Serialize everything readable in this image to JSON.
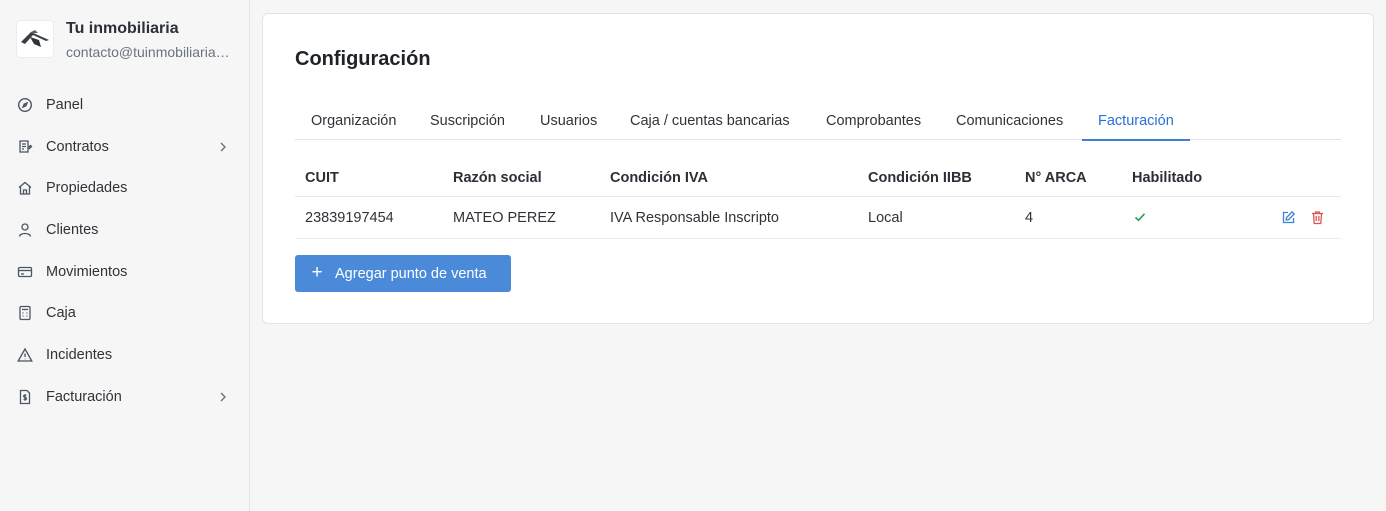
{
  "brand": {
    "name": "Tu inmobiliaria",
    "email": "contacto@tuinmobiliaria.com"
  },
  "nav": [
    {
      "label": "Panel",
      "icon": "gauge-icon",
      "has_submenu": false
    },
    {
      "label": "Contratos",
      "icon": "contract-icon",
      "has_submenu": true
    },
    {
      "label": "Propiedades",
      "icon": "home-icon",
      "has_submenu": false
    },
    {
      "label": "Clientes",
      "icon": "user-icon",
      "has_submenu": false
    },
    {
      "label": "Movimientos",
      "icon": "credit-card-icon",
      "has_submenu": false
    },
    {
      "label": "Caja",
      "icon": "calculator-icon",
      "has_submenu": false
    },
    {
      "label": "Incidentes",
      "icon": "warning-icon",
      "has_submenu": false
    },
    {
      "label": "Facturación",
      "icon": "invoice-icon",
      "has_submenu": true
    }
  ],
  "page": {
    "title": "Configuración"
  },
  "tabs": [
    {
      "label": "Organización",
      "active": false
    },
    {
      "label": "Suscripción",
      "active": false
    },
    {
      "label": "Usuarios",
      "active": false
    },
    {
      "label": "Caja / cuentas bancarias",
      "active": false
    },
    {
      "label": "Comprobantes",
      "active": false
    },
    {
      "label": "Comunicaciones",
      "active": false
    },
    {
      "label": "Facturación",
      "active": true
    }
  ],
  "table": {
    "headers": [
      "CUIT",
      "Razón social",
      "Condición IVA",
      "Condición IIBB",
      "N° ARCA",
      "Habilitado"
    ],
    "rows": [
      {
        "cuit": "23839197454",
        "razon_social": "MATEO PEREZ",
        "condicion_iva": "IVA Responsable Inscripto",
        "condicion_iibb": "Local",
        "n_arca": "4",
        "habilitado": true
      }
    ]
  },
  "actions": {
    "add_label": "Agregar punto de venta",
    "add_icon": "plus-icon",
    "edit_icon": "edit-icon",
    "delete_icon": "trash-icon"
  },
  "colors": {
    "accent": "#3b82d6",
    "button": "#4a8ad9",
    "check": "#22a05a",
    "delete": "#e05252",
    "background": "#f6f6f7"
  }
}
